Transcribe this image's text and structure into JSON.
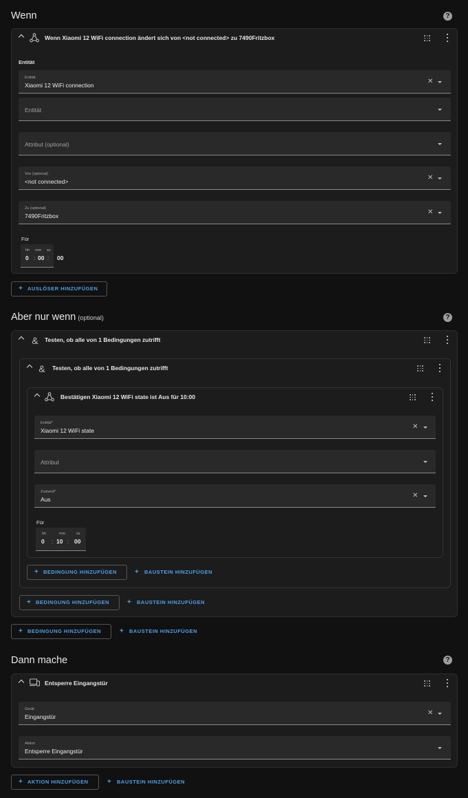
{
  "triggers": {
    "title": "Wenn",
    "card_title": "Wenn Xiaomi 12 WiFi connection ändert sich von <not connected> zu 7490Fritzbox",
    "entity_section": "Entität",
    "entity_label": "Entität",
    "entity_value": "Xiaomi 12 WiFi connection",
    "entity2_placeholder": "Entität",
    "attribute_placeholder": "Attribut (optional)",
    "from_label": "Von (optional)",
    "from_value": "<not connected>",
    "to_label": "Zu (optional)",
    "to_value": "7490Fritzbox",
    "for_label": "Für",
    "duration": {
      "h_label": "hh",
      "m_label": "mm",
      "s_label": "ss",
      "h": "0",
      "m": "00",
      "s": "00"
    },
    "add_button": "AUSLÖSER HINZUFÜGEN"
  },
  "conditions": {
    "title": "Aber nur wenn",
    "title_optional": "(optional)",
    "outer_title": "Testen, ob alle von 1 Bedingungen zutrifft",
    "inner_title": "Testen, ob alle von 1 Bedingungen zutrifft",
    "state_title": "Bestätigen Xiaomi 12 WiFi state ist Aus für 10:00",
    "entity_label": "Entität*",
    "entity_value": "Xiaomi 12 WiFi state",
    "attribute_placeholder": "Attribut",
    "state_label": "Zustand*",
    "state_value": "Aus",
    "for_label": "Für",
    "duration": {
      "h_label": "hh",
      "m_label": "mm",
      "s_label": "ss",
      "h": "0",
      "m": "10",
      "s": "00"
    },
    "add_condition": "BEDINGUNG HINZUFÜGEN",
    "add_block": "BAUSTEIN HINZUFÜGEN"
  },
  "actions": {
    "title": "Dann mache",
    "card_title": "Entsperre Eingangstür",
    "device_label": "Gerät",
    "device_value": "Eingangstür",
    "action_label": "Aktion",
    "action_value": "Entsperre Eingangstür",
    "add_action": "AKTION HINZUFÜGEN",
    "add_block": "BAUSTEIN HINZUFÜGEN"
  },
  "icons": {
    "help": "help-circle-icon",
    "collapse": "chevron-up-icon",
    "drag": "drag-handle-icon",
    "menu": "dots-vertical-icon",
    "state_trigger": "state-machine-icon",
    "and": "ampersand-icon",
    "device": "devices-icon",
    "clear": "close-icon",
    "dropdown": "menu-down-icon",
    "add": "plus-icon"
  },
  "colors": {
    "accent": "#4ea0e6",
    "background": "#111111",
    "card": "#1c1c1c"
  }
}
